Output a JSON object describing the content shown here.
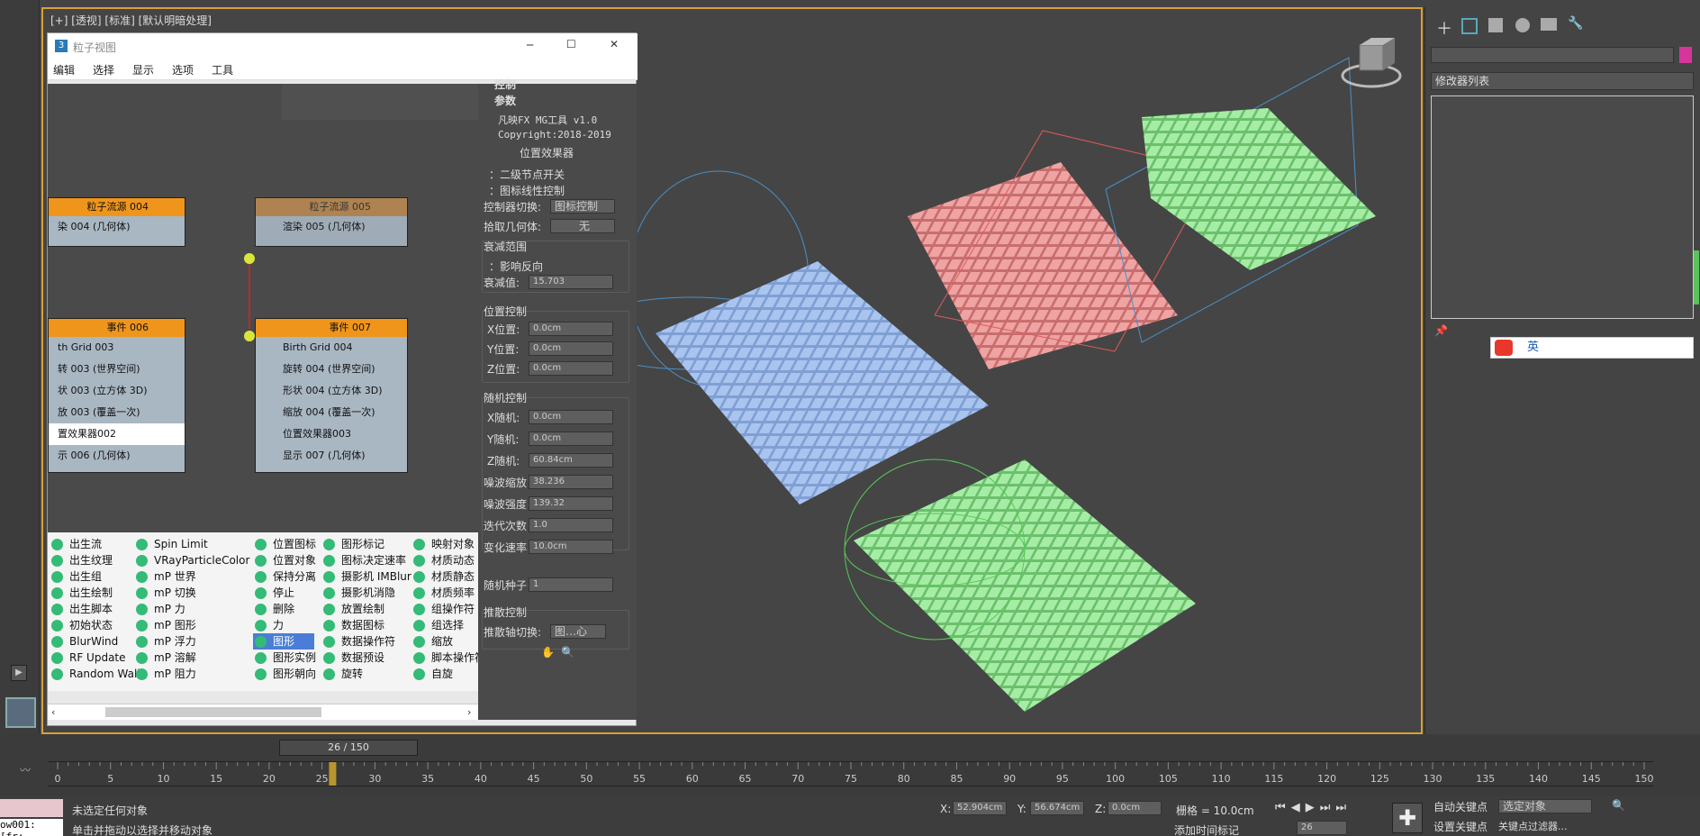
{
  "viewport": {
    "label": "[+] [透视] [标准] [默认明暗处理]"
  },
  "window": {
    "title": "粒子视图",
    "icon": "3",
    "min": "─",
    "max": "☐",
    "close": "✕"
  },
  "menu": [
    "编辑",
    "选择",
    "显示",
    "选项",
    "工具"
  ],
  "nodes": {
    "left_top": {
      "header": "粒子流源 004",
      "row": "染 004 (几何体)"
    },
    "right_top": {
      "header": "粒子流源 005",
      "row": "渲染 005 (几何体)"
    },
    "left_event": {
      "header": "事件 006",
      "rows": [
        "th Grid 003",
        "转 003 (世界空间)",
        "状 003 (立方体 3D)",
        "放 003 (覆盖一次)",
        "置效果器002",
        "示 006 (几何体)"
      ]
    },
    "right_event": {
      "header": "事件 007",
      "rows": [
        "Birth Grid 004",
        "旋转 004 (世界空间)",
        "形状 004 (立方体 3D)",
        "缩放 004 (覆盖一次)",
        "位置效果器003",
        "显示 007 (几何体)"
      ]
    }
  },
  "palette": [
    [
      "出生流",
      "出生纹理",
      "出生组",
      "出生绘制",
      "出生脚本",
      "初始状态",
      "BlurWind",
      "RF Update",
      "Random Walk"
    ],
    [
      "Spin Limit",
      "VRayParticleColor",
      "mP 世界",
      "mP 切换",
      "mP 力",
      "mP 图形",
      "mP 浮力",
      "mP 溶解",
      "mP 阻力"
    ],
    [
      "位置图标",
      "位置对象",
      "保持分离",
      "停止",
      "删除",
      "力",
      "图形",
      "图形实例",
      "图形朝向"
    ],
    [
      "图形标记",
      "图标决定速率",
      "摄影机 IMBlur",
      "摄影机消隐",
      "放置绘制",
      "数据图标",
      "数据操作符",
      "数据预设",
      "旋转"
    ],
    [
      "映射对象",
      "材质动态",
      "材质静态",
      "材质频率",
      "组操作符",
      "组选择",
      "缩放",
      "脚本操作符",
      "自旋"
    ]
  ],
  "rollout": {
    "header_cut": "控制",
    "header": "参数",
    "line1": "凡映FX  MG工具 v1.0",
    "line2": "Copyright:2018-2019",
    "line3": "位置效果器",
    "chk1": "：二级节点开关",
    "chk2": "：图标线性控制",
    "ctrl_switch_label": "控制器切换:",
    "ctrl_switch_val": "图标控制",
    "pick_label": "拾取几何体:",
    "pick_val": "无",
    "falloff_title": "衰减范围",
    "falloff_chk": "：影响反向",
    "falloff_label": "衰减值:",
    "falloff_val": "15.703",
    "pos_title": "位置控制",
    "x_label": "X位置:",
    "x_val": "0.0cm",
    "y_label": "Y位置:",
    "y_val": "0.0cm",
    "z_label": "Z位置:",
    "z_val": "0.0cm",
    "rand_title": "随机控制",
    "xr_label": "X随机:",
    "xr_val": "0.0cm",
    "yr_label": "Y随机:",
    "yr_val": "0.0cm",
    "zr_label": "Z随机:",
    "zr_val": "60.84cm",
    "ns_label": "噪波缩放",
    "ns_val": "38.236",
    "nst_label": "噪波强度",
    "nst_val": "139.32",
    "it_label": "迭代次数",
    "it_val": "1.0",
    "cr_label": "变化速率",
    "cr_val": "10.0cm",
    "seed_label": "随机种子",
    "seed_val": "1",
    "push_title": "推散控制",
    "push_label": "推散轴切换:",
    "push_val": "图…心"
  },
  "cmd": {
    "modifier_list": "修改器列表",
    "ime": "英"
  },
  "timeline": {
    "frame": "26 / 150",
    "ticks": [
      "0",
      "5",
      "10",
      "15",
      "20",
      "25",
      "30",
      "35",
      "40",
      "45",
      "50",
      "55",
      "60",
      "65",
      "70",
      "75",
      "80",
      "85",
      "90",
      "95",
      "100",
      "105",
      "110",
      "115",
      "120",
      "125",
      "130",
      "135",
      "140",
      "145",
      "150"
    ],
    "current": 26,
    "max": 150
  },
  "status": {
    "line1": "未选定任何对象",
    "line2": "单击并拖动以选择并移动对象",
    "script": "ow001: [fr:",
    "x_label": "X:",
    "x_val": "52.904cm",
    "y_label": "Y:",
    "y_val": "56.674cm",
    "z_label": "Z:",
    "z_val": "0.0cm",
    "grid": "栅格 = 10.0cm",
    "add_time_tag": "添加时间标记",
    "auto_key": "自动关键点",
    "set_key": "设置关键点",
    "sel_obj": "选定对象",
    "key_filter": "关键点过滤器...",
    "frame_field": "26"
  }
}
